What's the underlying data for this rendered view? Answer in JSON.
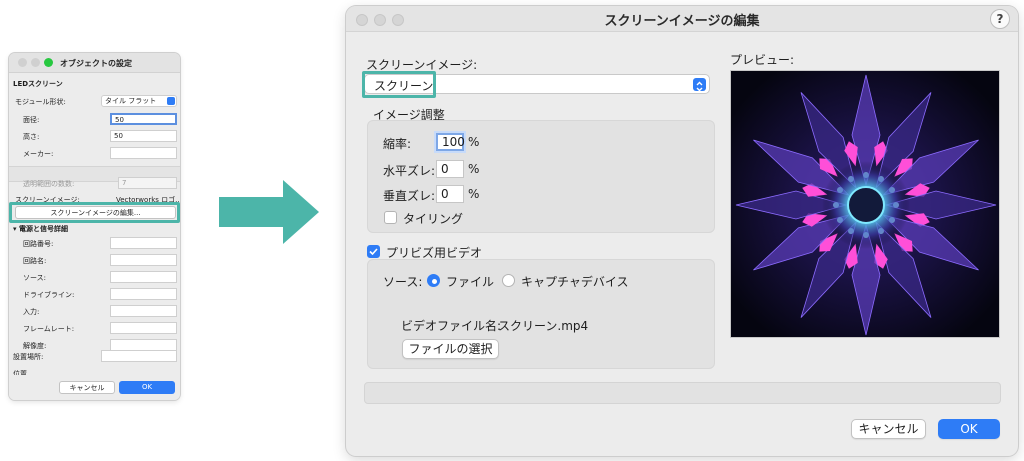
{
  "small_dialog": {
    "title": "オブジェクトの設定",
    "section_led": "LEDスクリーン",
    "module_shape_label": "モジュール形状:",
    "module_shape_value": "タイル フラット",
    "width_label": "面径:",
    "width_value": "50",
    "height_label": "高さ:",
    "height_value": "50",
    "maker_label": "メーカー:",
    "maker_value": "",
    "count_label": "透明範囲の数数:",
    "count_value": "7",
    "screen_image_label": "スクリーンイメージ:",
    "screen_image_value": "Vectorworks ロゴ...",
    "edit_button": "スクリーンイメージの編集...",
    "power_section": "電源と信号詳細",
    "fields": [
      {
        "label": "回路番号:",
        "value": ""
      },
      {
        "label": "回路名:",
        "value": ""
      },
      {
        "label": "ソース:",
        "value": ""
      },
      {
        "label": "ドライブライン:",
        "value": ""
      },
      {
        "label": "入力:",
        "value": ""
      },
      {
        "label": "フレームレート:",
        "value": ""
      },
      {
        "label": "解像度:",
        "value": ""
      }
    ],
    "location_label": "設置場所:",
    "location_value": "",
    "cut_label": "位置",
    "cancel_label": "キャンセル",
    "ok_label": "OK"
  },
  "dialog": {
    "title": "スクリーンイメージの編集",
    "help_label": "?",
    "screen_image_label": "スクリーンイメージ:",
    "screen_image_value": "スクリーン",
    "image_adjust_label": "イメージ調整",
    "scale_label": "縮率:",
    "scale_value": "100",
    "h_offset_label": "水平ズレ:",
    "h_offset_value": "0",
    "v_offset_label": "垂直ズレ:",
    "v_offset_value": "0",
    "unit_percent": "%",
    "tiling_label": "タイリング",
    "tiling_checked": false,
    "previz_label": "プリビズ用ビデオ",
    "previz_checked": true,
    "source_label": "ソース:",
    "source_file_label": "ファイル",
    "source_capture_label": "キャプチャデバイス",
    "source_selected": "ファイル",
    "video_file_label": "ビデオファイル名:",
    "video_file_value": "スクリーン.mp4",
    "select_file_button": "ファイルの選択",
    "preview_label": "プレビュー:",
    "cancel_label": "キャンセル",
    "ok_label": "OK"
  },
  "colors": {
    "accent": "#2e7cf6",
    "highlight": "#4cb5a9",
    "window_bg": "#ececec"
  },
  "icons": {
    "help": "question-mark-icon",
    "popup_chevron": "chevron-up-down-icon",
    "arrow": "right-arrow-icon"
  }
}
